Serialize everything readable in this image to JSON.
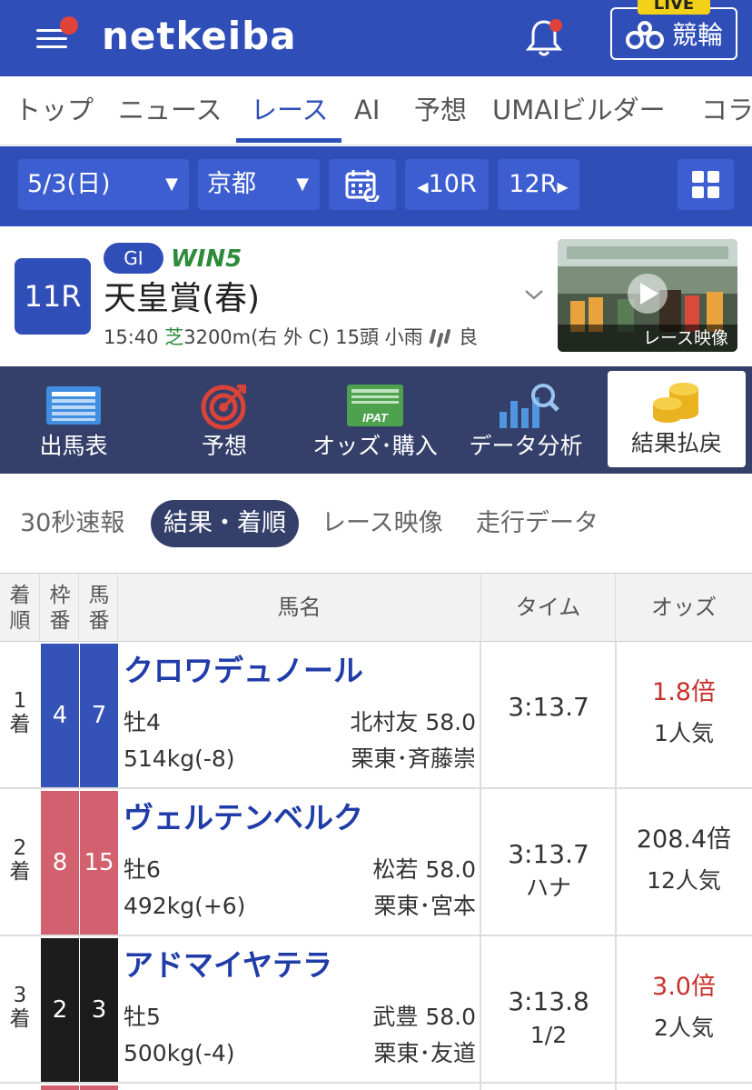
{
  "header": {
    "logo": "netkeiba",
    "live_tag": "LIVE",
    "keirin_label": "競輪"
  },
  "gnav": {
    "items": [
      "トップ",
      "ニュース",
      "レース",
      "AI",
      "予想",
      "UMAIビルダー",
      "コラ"
    ],
    "active": "レース"
  },
  "selector": {
    "date": "5/3(日)",
    "venue": "京都",
    "prev": "10R",
    "next": "12R"
  },
  "race": {
    "number": "11R",
    "grade": "GI",
    "win5": "WIN5",
    "name": "天皇賞(春)",
    "time": "15:40",
    "surface": "芝",
    "distance": "3200m(右 外 C)",
    "heads": "15頭",
    "weather": "小雨",
    "condition": "良",
    "video_label": "レース映像"
  },
  "race_menu": [
    {
      "label": "出馬表",
      "icon": "horse-list-icon"
    },
    {
      "label": "予想",
      "icon": "target-icon"
    },
    {
      "label": "オッズ･購入",
      "icon": "ipat-icon"
    },
    {
      "label": "データ分析",
      "icon": "chart-search-icon"
    },
    {
      "label": "結果払戻",
      "icon": "coins-icon"
    }
  ],
  "sub_tabs": [
    "30秒速報",
    "結果・着順",
    "レース映像",
    "走行データ"
  ],
  "table": {
    "headers": {
      "rank": "着順",
      "waku": "枠番",
      "umaban": "馬番",
      "name": "馬名",
      "time": "タイム",
      "odds": "オッズ"
    },
    "rows": [
      {
        "rank": "1",
        "rank_suffix": "着",
        "waku": "4",
        "umaban": "7",
        "waku_color": "#3552b8",
        "name": "クロワデュノール",
        "sex_age": "牡4",
        "jockey_weight": "北村友 58.0",
        "body_weight": "514kg(-8)",
        "trainer": "栗東･斉藤崇",
        "time": "3:13.7",
        "margin": "",
        "odds": "1.8倍",
        "odds_fav": true,
        "popularity": "1人気"
      },
      {
        "rank": "2",
        "rank_suffix": "着",
        "waku": "8",
        "umaban": "15",
        "waku_color": "#d2606e",
        "name": "ヴェルテンベルク",
        "sex_age": "牡6",
        "jockey_weight": "松若 58.0",
        "body_weight": "492kg(+6)",
        "trainer": "栗東･宮本",
        "time": "3:13.7",
        "margin": "ハナ",
        "odds": "208.4倍",
        "odds_fav": false,
        "popularity": "12人気"
      },
      {
        "rank": "3",
        "rank_suffix": "着",
        "waku": "2",
        "umaban": "3",
        "waku_color": "#1c1c1c",
        "name": "アドマイヤテラ",
        "sex_age": "牡5",
        "jockey_weight": "武豊 58.0",
        "body_weight": "500kg(-4)",
        "trainer": "栗東･友道",
        "time": "3:13.8",
        "margin": "1/2",
        "odds": "3.0倍",
        "odds_fav": true,
        "popularity": "2人気"
      }
    ]
  },
  "colors": {
    "brand": "#2f4eb8",
    "menu_bg": "#34406a",
    "fav_odds": "#c8302a"
  }
}
